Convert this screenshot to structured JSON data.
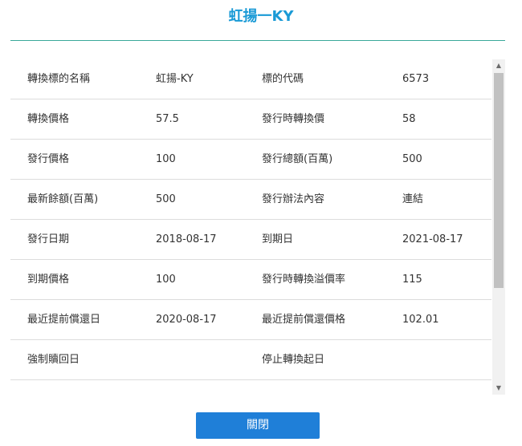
{
  "dialog": {
    "title": "虹揚一KY",
    "close_label": "關閉"
  },
  "table": {
    "rows": [
      [
        "轉換標的名稱",
        "虹揚-KY",
        "標的代碼",
        "6573"
      ],
      [
        "轉換價格",
        "57.5",
        "發行時轉換價",
        "58"
      ],
      [
        "發行價格",
        "100",
        "發行總額(百萬)",
        "500"
      ],
      [
        "最新餘額(百萬)",
        "500",
        "發行辦法內容",
        "連結"
      ],
      [
        "發行日期",
        "2018-08-17",
        "到期日",
        "2021-08-17"
      ],
      [
        "到期價格",
        "100",
        "發行時轉換溢價率",
        "115"
      ],
      [
        "最近提前償還日",
        "2020-08-17",
        "最近提前償還價格",
        "102.01"
      ],
      [
        "強制贖回日",
        "",
        "停止轉換起日",
        ""
      ],
      [
        "",
        "",
        "",
        ""
      ]
    ]
  },
  "scrollbar": {
    "up_icon": "▲",
    "down_icon": "▼"
  }
}
